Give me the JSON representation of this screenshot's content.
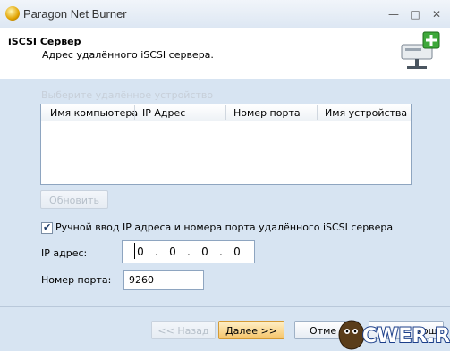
{
  "window": {
    "title": "Paragon Net Burner"
  },
  "header": {
    "title": "iSCSI Сервер",
    "subtitle": "Адрес удалённого iSCSI сервера."
  },
  "device_group": {
    "label": "Выберите удалённое устройство",
    "columns": [
      "Имя компьютера",
      "IP Адрес",
      "Номер порта",
      "Имя устройства"
    ],
    "rows": []
  },
  "refresh_button": {
    "label": "Обновить"
  },
  "manual_entry": {
    "label": "Ручной ввод IP адреса и номера порта удалённого iSCSI сервера",
    "checked": true
  },
  "ip": {
    "label": "IP адрес:",
    "octets": [
      "0",
      "0",
      "0",
      "0"
    ]
  },
  "port": {
    "label": "Номер порта:",
    "value": "9260"
  },
  "footer": {
    "back": "<< Назад",
    "next": "Далее >>",
    "cancel": "Отме",
    "help": "мощ"
  },
  "watermark": {
    "text": "CWER.RU"
  }
}
